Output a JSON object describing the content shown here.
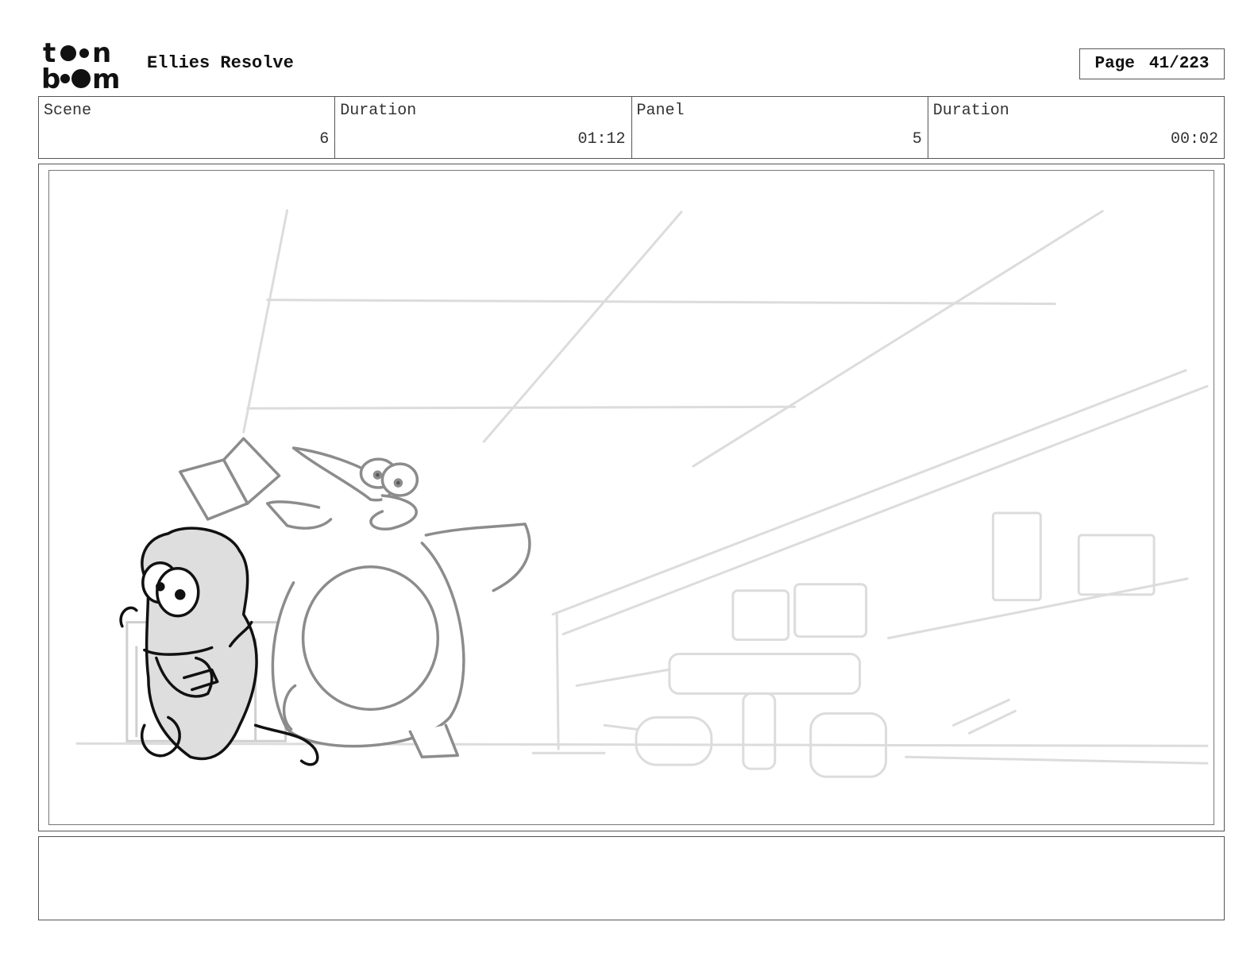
{
  "header": {
    "logo_text": "toon boom",
    "title": "Ellies Resolve",
    "page_label": "Page",
    "page_number": "41/223"
  },
  "info": {
    "scene_label": "Scene",
    "scene_value": "6",
    "scene_duration_label": "Duration",
    "scene_duration_value": "01:12",
    "panel_label": "Panel",
    "panel_value": "5",
    "panel_duration_label": "Duration",
    "panel_duration_value": "00:02"
  },
  "notes": {
    "text": ""
  }
}
